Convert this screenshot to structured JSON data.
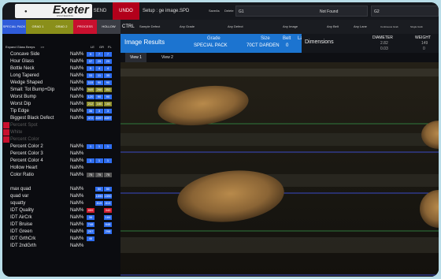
{
  "topbar": {
    "logo": "Exeter",
    "logo_sub": "ENGINEERING",
    "send": "SEND",
    "undo": "UNDO",
    "setup": "Setup : ge image.SPD",
    "save_as": "SaveAs",
    "delete": "Delete",
    "field1": "G1",
    "not_found": "Not Found",
    "field2": "G2"
  },
  "modes": [
    {
      "label": "SPECIAL PACK",
      "color": "#2f5cd9"
    },
    {
      "label": "GRAD 1",
      "color": "#8a8f1a"
    },
    {
      "label": "GRAD 2",
      "color": "#8a8f1a"
    },
    {
      "label": "PROCESS",
      "color": "#c8102e"
    },
    {
      "label": "HOLLOW",
      "color": "#3a3c44"
    }
  ],
  "mode_row": {
    "ctrl": "CTRL",
    "items": [
      "Sample Defect",
      "Any Grade",
      "Any Defect",
      "Any Image",
      "Any Belt",
      "Any Lane",
      "Continuous Grab",
      "Single Grab"
    ]
  },
  "left_panel": {
    "expand": "Expand Glass Beeps",
    "chevrons": ">>",
    "col_lo": "LE",
    "col_gr": "GR",
    "col_fl": "FL",
    "rows": [
      {
        "label": "Concave Side",
        "nan": "NaN%",
        "vals": [
          "9",
          "7",
          "7"
        ],
        "style": "blue"
      },
      {
        "label": "Hour Glass",
        "nan": "NaN%",
        "vals": [
          "37",
          "29",
          "29"
        ],
        "style": "blue"
      },
      {
        "label": "Bottle Neck",
        "nan": "NaN%",
        "vals": [
          "5",
          "4",
          "4"
        ],
        "style": "blue"
      },
      {
        "label": "Long Tapered",
        "nan": "NaN%",
        "vals": [
          "33",
          "11",
          "35"
        ],
        "style": "blue"
      },
      {
        "label": "Wedge Shaped",
        "nan": "NaN%",
        "vals": [
          "115",
          "90",
          "90"
        ],
        "style": "blue"
      },
      {
        "label": "Small: Tot Bump+Dip",
        "nan": "NaN%",
        "vals": [
          "949",
          "268",
          "352"
        ],
        "style": "olive"
      },
      {
        "label": "Worst Bump",
        "nan": "NaN%",
        "vals": [
          "120",
          "90",
          "90"
        ],
        "style": "blue"
      },
      {
        "label": "Worst Dip",
        "nan": "NaN%",
        "vals": [
          "212",
          "160",
          "160"
        ],
        "style": "olive"
      },
      {
        "label": "Tip Edge",
        "nan": "NaN%",
        "vals": [
          "36",
          "3",
          "3"
        ],
        "style": "blue"
      },
      {
        "label": "Biggest Black Defect",
        "nan": "NaN%",
        "vals": [
          "472",
          "8397",
          "8397"
        ],
        "style": "blue"
      },
      {
        "label": "Percent Spot",
        "nan": "",
        "vals": [],
        "style": "dim"
      },
      {
        "label": "White",
        "nan": "",
        "vals": [],
        "style": "dim"
      },
      {
        "label": "Percent Color",
        "nan": "",
        "vals": [],
        "style": "dim"
      },
      {
        "label": "Percent Color 2",
        "nan": "NaN%",
        "vals": [
          "1",
          "1",
          "1"
        ],
        "style": "blue"
      },
      {
        "label": "Percent Color 3",
        "nan": "NaN%",
        "vals": [],
        "style": "none"
      },
      {
        "label": "Percent Color 4",
        "nan": "NaN%",
        "vals": [
          "1",
          "1",
          "1"
        ],
        "style": "blue"
      },
      {
        "label": "Hollow Heart",
        "nan": "NaN%",
        "vals": [],
        "style": "none"
      },
      {
        "label": "Color Ratio",
        "nan": "NaN%",
        "vals": [
          "75",
          "75",
          "75"
        ],
        "style": "grey"
      },
      {
        "label": "",
        "nan": "",
        "vals": [],
        "style": "none"
      },
      {
        "label": "max quad",
        "nan": "NaN%",
        "vals": [
          "",
          "50",
          "50"
        ],
        "style": "blue"
      },
      {
        "label": "quad var",
        "nan": "NaN%",
        "vals": [
          "",
          "1590",
          "1590"
        ],
        "style": "blue"
      },
      {
        "label": "squatty",
        "nan": "NaN%",
        "vals": [
          "",
          "819",
          "819"
        ],
        "style": "blue"
      },
      {
        "label": "IDT Quality",
        "nan": "NaN%",
        "vals": [
          "859",
          "",
          "340"
        ],
        "style": "red"
      },
      {
        "label": "IDT AirCrk",
        "nan": "NaN%",
        "vals": [
          "36",
          "",
          "184"
        ],
        "style": "blue"
      },
      {
        "label": "IDT Bruise",
        "nan": "NaN%",
        "vals": [
          "748",
          "",
          "648"
        ],
        "style": "blue"
      },
      {
        "label": "IDT Green",
        "nan": "NaN%",
        "vals": [
          "297",
          "",
          "298"
        ],
        "style": "blue"
      },
      {
        "label": "IDT GrthCrk",
        "nan": "NaN%",
        "vals": [
          "46",
          "",
          ""
        ],
        "style": "blue"
      },
      {
        "label": "IDT 2ndGrth",
        "nan": "NaN%",
        "vals": [],
        "style": "none"
      }
    ]
  },
  "results": {
    "title": "Image Results",
    "grade_label": "Grade",
    "grade_value": "SPECIAL PACK",
    "size_label": "Size",
    "size_value": "70CT DARDEN",
    "belt_label": "Belt",
    "belt_value": "0",
    "lane_label": "Lane",
    "lane_value": "4"
  },
  "dimensions": {
    "title": "Dimensions",
    "diameter_label": "DIAMETER",
    "diameter_v1": "2.82",
    "diameter_v2": "0.03",
    "weight_label": "WEIGHT",
    "weight_v1": "149",
    "weight_v2": "0"
  },
  "views": [
    "View 1",
    "View 2"
  ],
  "colors": {
    "accent_blue": "#1c74d0",
    "cell_blue": "#2e6df0",
    "cell_olive": "#8d8d2a",
    "cell_red": "#d11d2f",
    "undo_red": "#b3001b"
  }
}
